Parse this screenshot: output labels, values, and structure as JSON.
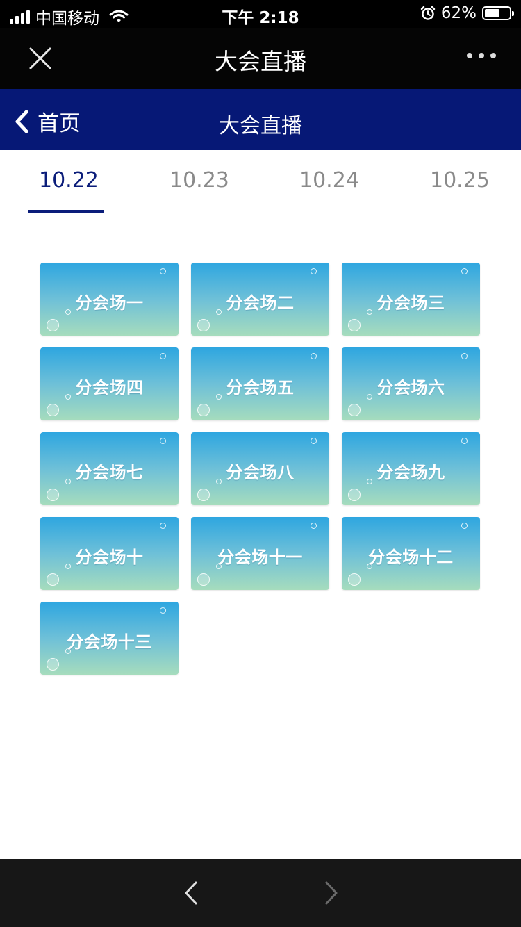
{
  "status_bar": {
    "carrier": "中国移动",
    "time": "下午 2:18",
    "battery": "62%",
    "battery_level": 0.62
  },
  "wechat_bar": {
    "title": "大会直播",
    "close_icon": "close-icon",
    "more_icon": "more-icon"
  },
  "nav": {
    "back_label": "首页",
    "title": "大会直播"
  },
  "tabs": [
    {
      "label": "10.22",
      "active": true
    },
    {
      "label": "10.23",
      "active": false
    },
    {
      "label": "10.24",
      "active": false
    },
    {
      "label": "10.25",
      "active": false
    }
  ],
  "venues": [
    "分会场一",
    "分会场二",
    "分会场三",
    "分会场四",
    "分会场五",
    "分会场六",
    "分会场七",
    "分会场八",
    "分会场九",
    "分会场十",
    "分会场十一",
    "分会场十二",
    "分会场十三"
  ],
  "colors": {
    "nav_bg": "#061876",
    "accent": "#0b1d7a",
    "tile_top": "#2ea6e0",
    "tile_bottom": "#a6dcbd"
  }
}
